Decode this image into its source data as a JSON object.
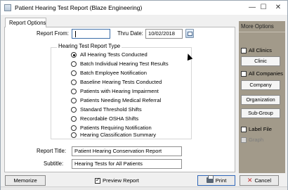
{
  "window": {
    "title": "Patient Hearing Test Report (Blaze Engineering)",
    "controls": {
      "minimize": "—",
      "maximize": "☐",
      "close": "✕"
    }
  },
  "tabs": [
    {
      "label": "Report Options",
      "active": true
    }
  ],
  "form": {
    "report_from_label": "Report From:",
    "report_from_value": "",
    "thru_date_label": "Thru Date:",
    "thru_date_value": "10/02/2018",
    "group_title": "Hearing Test Report Type",
    "report_types": [
      {
        "label": "All Hearing Tests Conducted",
        "selected": true
      },
      {
        "label": "Batch Individual Hearing Test Results",
        "selected": false
      },
      {
        "label": "Batch Employee Notification",
        "selected": false
      },
      {
        "label": "Baseline Hearing Tests Conducted",
        "selected": false
      },
      {
        "label": "Patients with Hearing Impairment",
        "selected": false
      },
      {
        "label": "Patients Needing Medical Referral",
        "selected": false
      },
      {
        "label": "Standard Threshold Shifts",
        "selected": false
      },
      {
        "label": "Recordable OSHA Shifts",
        "selected": false
      },
      {
        "label": "Patients Requiring Notification",
        "selected": false
      },
      {
        "label": "Hearing Classification Summary",
        "selected": false
      }
    ],
    "report_title_label": "Report Title:",
    "report_title_value": "Patient Hearing Conservation Report",
    "subtitle_label": "Subtitle:",
    "subtitle_value": "Hearing Tests for All Patients"
  },
  "more_options": {
    "title": "More Options",
    "all_clinics_label": "All Clinics",
    "all_clinics_checked": false,
    "clinic_button": "Clinic",
    "all_companies_label": "All Companies",
    "all_companies_checked": false,
    "company_button": "Company",
    "organization_button": "Organization",
    "subgroup_button": "Sub-Group",
    "label_file_label": "Label File",
    "label_file_checked": false,
    "graph_label": "Graph",
    "graph_enabled": false
  },
  "footer": {
    "memorize_button": "Memorize",
    "preview_report_label": "Preview Report",
    "preview_report_checked": true,
    "print_button": "Print",
    "cancel_button": "Cancel"
  },
  "colors": {
    "more_options_panel": "#a29a8a",
    "focus_border": "#3c6ea8",
    "cancel_icon": "#c62828"
  }
}
